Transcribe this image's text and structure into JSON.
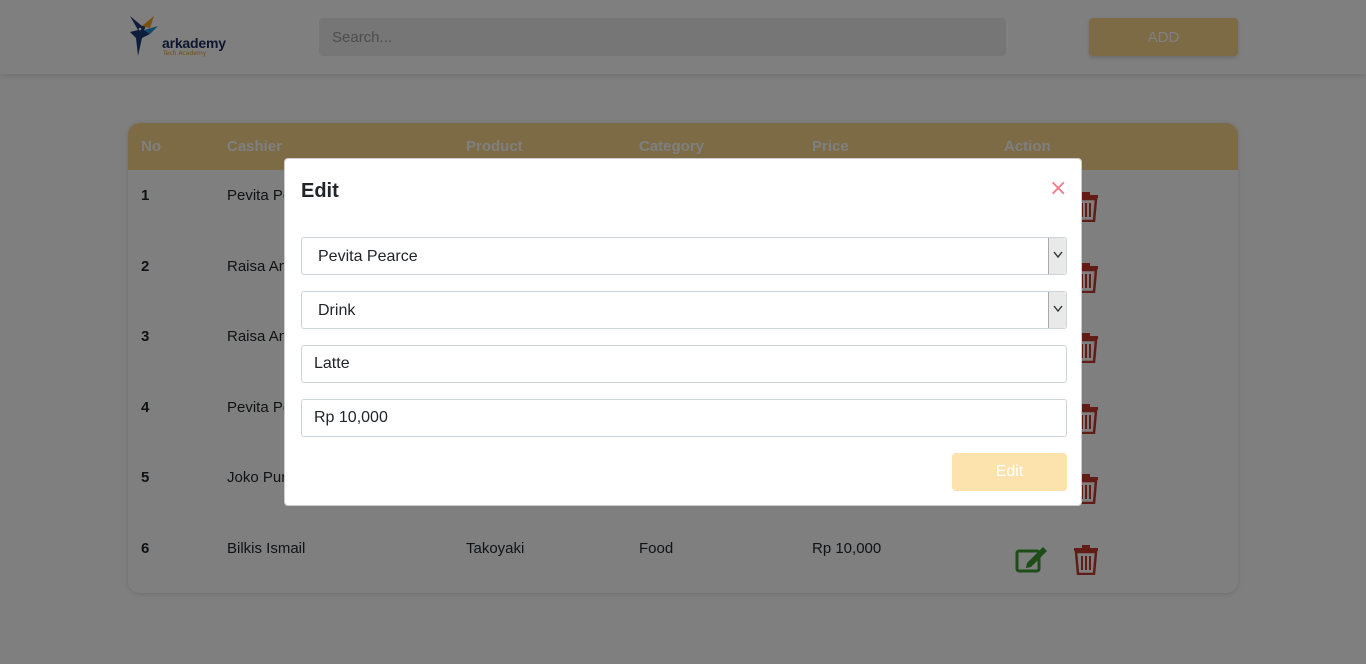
{
  "header": {
    "logo_text": "arkademy",
    "logo_sub": "Tech Academy",
    "search_placeholder": "Search...",
    "add_label": "ADD"
  },
  "table": {
    "columns": [
      "No",
      "Cashier",
      "Product",
      "Category",
      "Price",
      "Action"
    ],
    "rows": [
      {
        "no": "1",
        "cashier": "Pevita Pe",
        "product": "",
        "category": "",
        "price": ""
      },
      {
        "no": "2",
        "cashier": "Raisa An",
        "product": "",
        "category": "",
        "price": ""
      },
      {
        "no": "3",
        "cashier": "Raisa An",
        "product": "",
        "category": "",
        "price": ""
      },
      {
        "no": "4",
        "cashier": "Pevita Pe",
        "product": "",
        "category": "",
        "price": ""
      },
      {
        "no": "5",
        "cashier": "Joko Pur",
        "product": "",
        "category": "",
        "price": ""
      },
      {
        "no": "6",
        "cashier": "Bilkis Ismail",
        "product": "Takoyaki",
        "category": "Food",
        "price": "Rp 10,000"
      }
    ]
  },
  "modal": {
    "title": "Edit",
    "close_symbol": "×",
    "cashier_select": "Pevita Pearce",
    "category_select": "Drink",
    "product_value": "Latte",
    "price_value": "Rp 10,000",
    "submit_label": "Edit"
  },
  "colors": {
    "accent": "#fbd68a",
    "edit_icon": "#3c9a2e",
    "delete_icon": "#c0392b",
    "close": "#f27c8a"
  }
}
